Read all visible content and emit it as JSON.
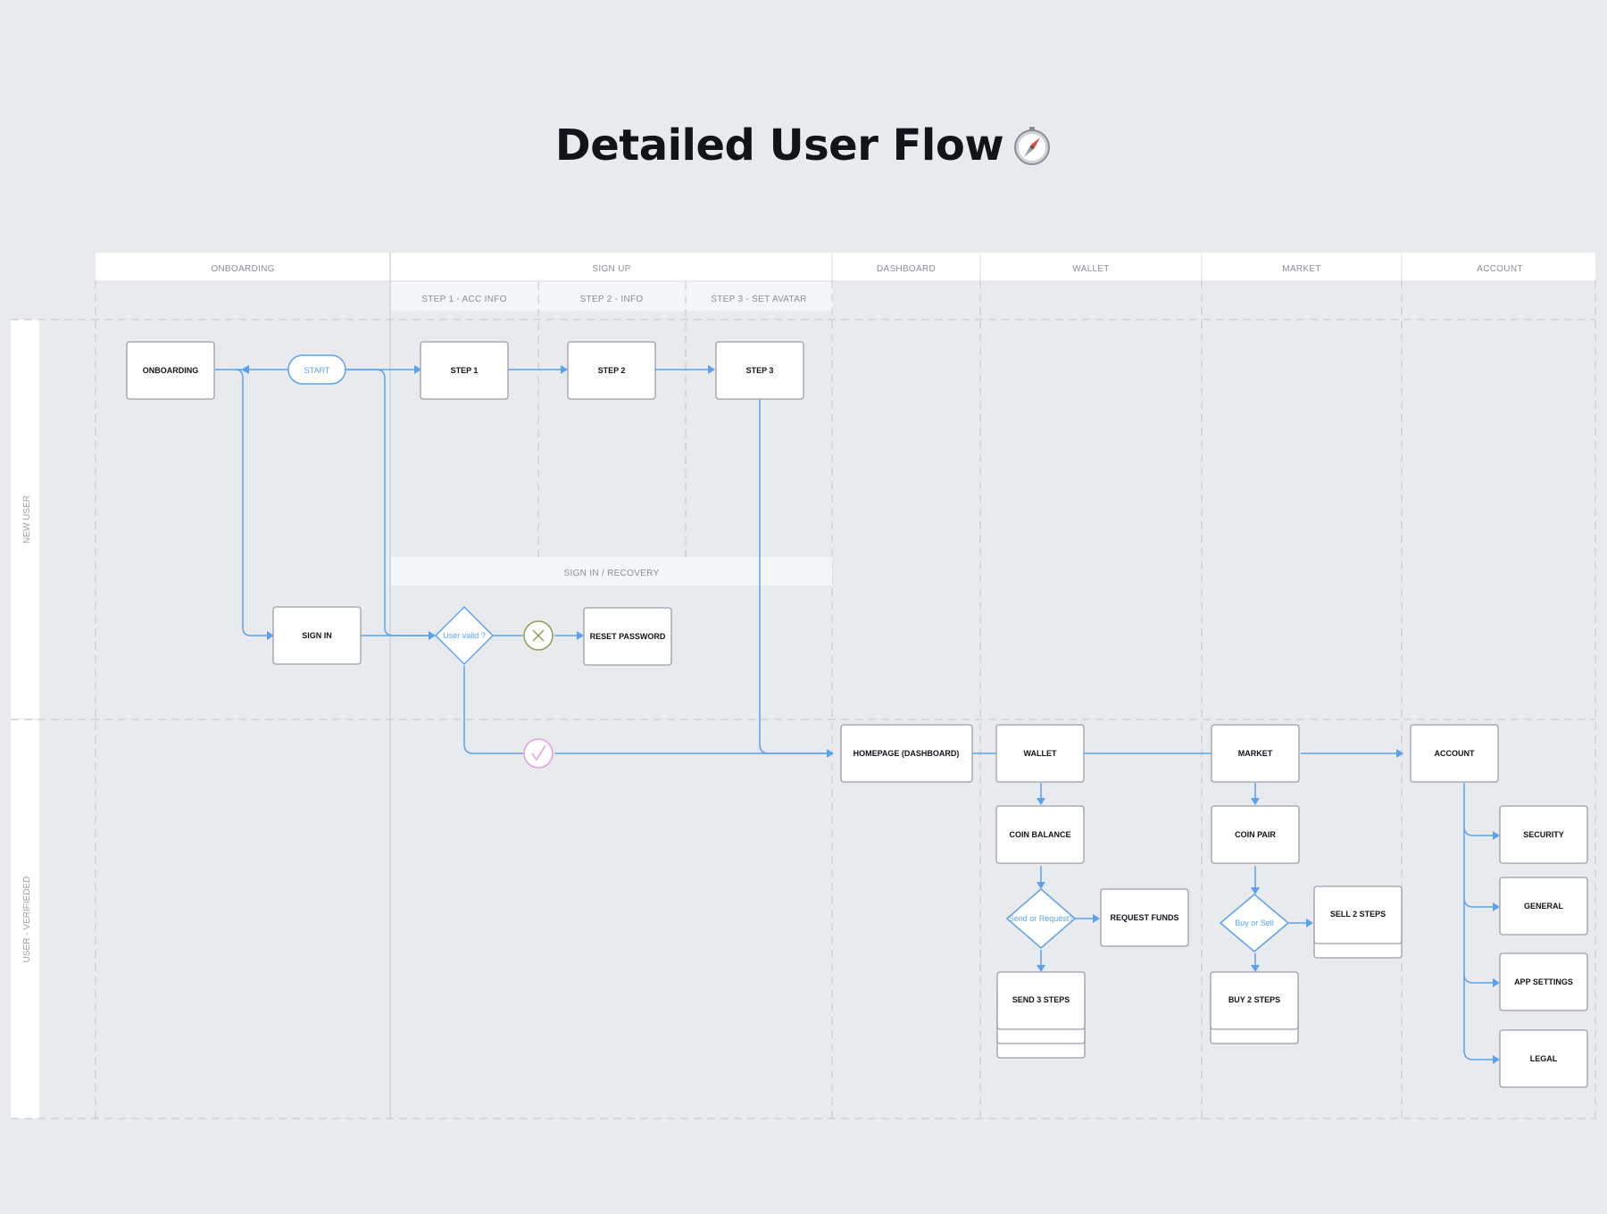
{
  "title": "Detailed User Flow",
  "title_icon": "compass-icon",
  "colors": {
    "background": "#e9eaee",
    "flow": "#5aa3ec",
    "box_border": "#9a9ea6",
    "reject": "#8aa050",
    "accept": "#e59ae8"
  },
  "columns": [
    "ONBOARDING",
    "SIGN UP",
    "DASHBOARD",
    "WALLET",
    "MARKET",
    "ACCOUNT"
  ],
  "subcolumns": [
    "STEP 1 - ACC INFO",
    "STEP 2 - INFO",
    "STEP 3 - SET AVATAR"
  ],
  "subsection": "SIGN IN / RECOVERY",
  "lanes": [
    "NEW USER",
    "USER - VERIFIEDED"
  ],
  "nodes": {
    "onboarding": "ONBOARDING",
    "start": "START",
    "step1": "STEP 1",
    "step2": "STEP 2",
    "step3": "STEP 3",
    "sign_in": "SIGN IN",
    "user_valid": "User valid ?",
    "reset_password": "RESET PASSWORD",
    "homepage": "HOMEPAGE (DASHBOARD)",
    "wallet": "WALLET",
    "coin_balance": "COIN BALANCE",
    "send_or_request": "Send or Request?",
    "request_funds": "REQUEST FUNDS",
    "send_steps": "SEND 3 STEPS",
    "market": "MARKET",
    "coin_pair": "COIN PAIR",
    "buy_or_sell": "Buy or Sell",
    "sell_steps": "SELL 2 STEPS",
    "buy_steps": "BUY 2 STEPS",
    "account": "ACCOUNT",
    "security": "SECURITY",
    "general": "GENERAL",
    "app_settings": "APP SETTINGS",
    "legal": "LEGAL"
  }
}
